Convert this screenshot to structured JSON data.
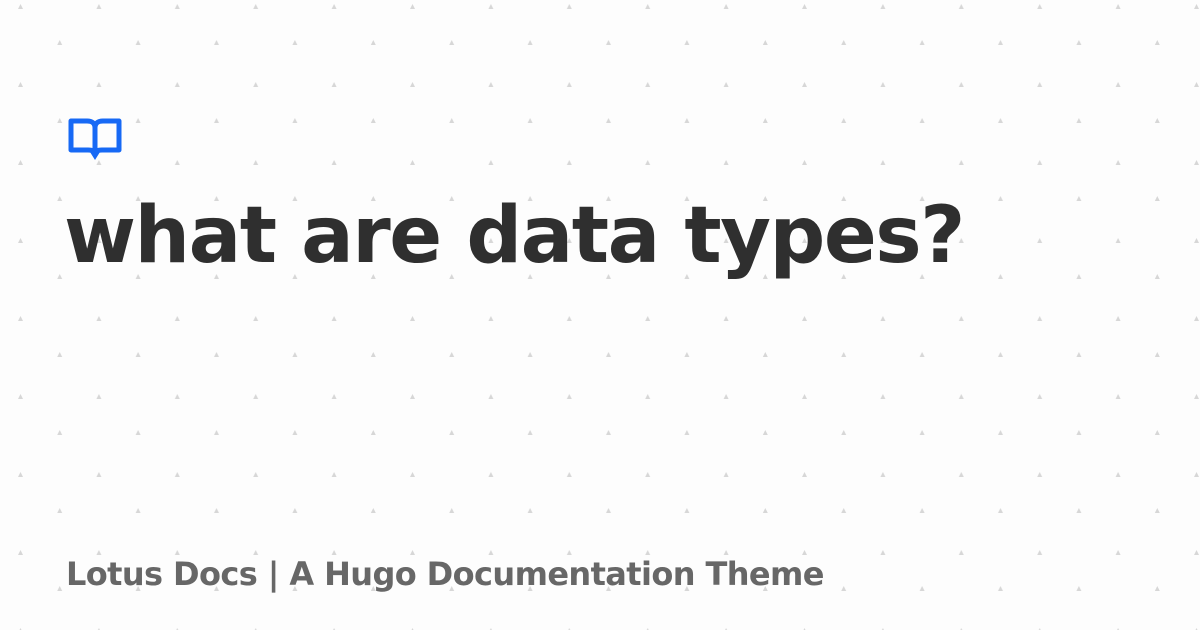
{
  "page": {
    "title": "what are data types?",
    "site_caption": "Lotus Docs | A Hugo Documentation Theme"
  },
  "icons": {
    "logo": "book-open-icon"
  },
  "colors": {
    "background": "#fdfdfd",
    "pattern_dot": "#d7d7d7",
    "logo": "#1769f5",
    "title": "#2f2f2f",
    "caption": "#676767"
  }
}
